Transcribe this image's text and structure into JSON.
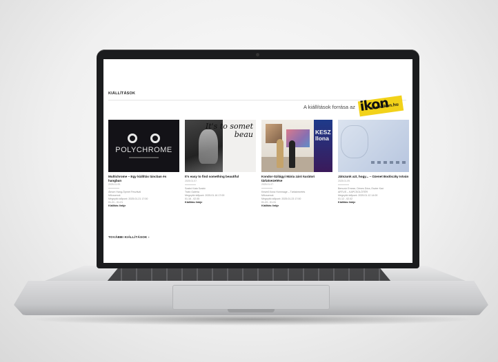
{
  "page": {
    "section_title": "KIÁLLÍTÁSOK",
    "source_text": "A kiállítások forrása az",
    "logo_url": "www.ikon.hu",
    "more_link": "TOVÁBBI KIÁLLÍTÁSOK",
    "more_chevron": "›"
  },
  "cards": [
    {
      "image_text": "POLYCHROME",
      "title": "Multichrome – Egy kiállítás táncban és hangban",
      "date": "2025.01.05.",
      "meta": [
        "Átrium Hang-Öpmet Fesztivál",
        "Műcsarnok",
        "Megnyitó időpont: 2025.01.21 17:00",
        "01.21 - 01.21"
      ],
      "link": "Kiállítás linkje"
    },
    {
      "image_text": "It's to somet beau",
      "title": "It's easy to find something beautiful",
      "date": "2025.01.07.",
      "meta": [
        "Szabó Kata Szabó",
        "Trafó Galéria",
        "Megnyitó időpont: 2025.01.16 17:00",
        "01.16 - 02.05"
      ],
      "link": "Kiállítás linkje"
    },
    {
      "image_text": "KESZ Ilona",
      "title": "Kondor-Szilágyi Mária záró kurátori tárlatvezetése",
      "date": "2025.01.07.",
      "meta": [
        "Keserű Ilona Hommage – Tárlatvezetés",
        "Műcsarnok",
        "Megnyitó időpont: 2025.01.23 17:00",
        "01.23 - 01.31"
      ],
      "link": "Kiállítás linkje"
    },
    {
      "image_text": "",
      "title": "Játszunk azt, hogy... – Ozenet Bodóczky István",
      "date": "2025.01.09.",
      "meta": [
        "Benczúr Emese, Dénes Dóra, Eszter Kaó",
        "ARTUS – KAPCSOLÓTÉR",
        "Megnyitó időpont: 2025.01.12 14:00",
        "01.12 - 02.02"
      ],
      "link": "Kiállítás linkje"
    }
  ]
}
